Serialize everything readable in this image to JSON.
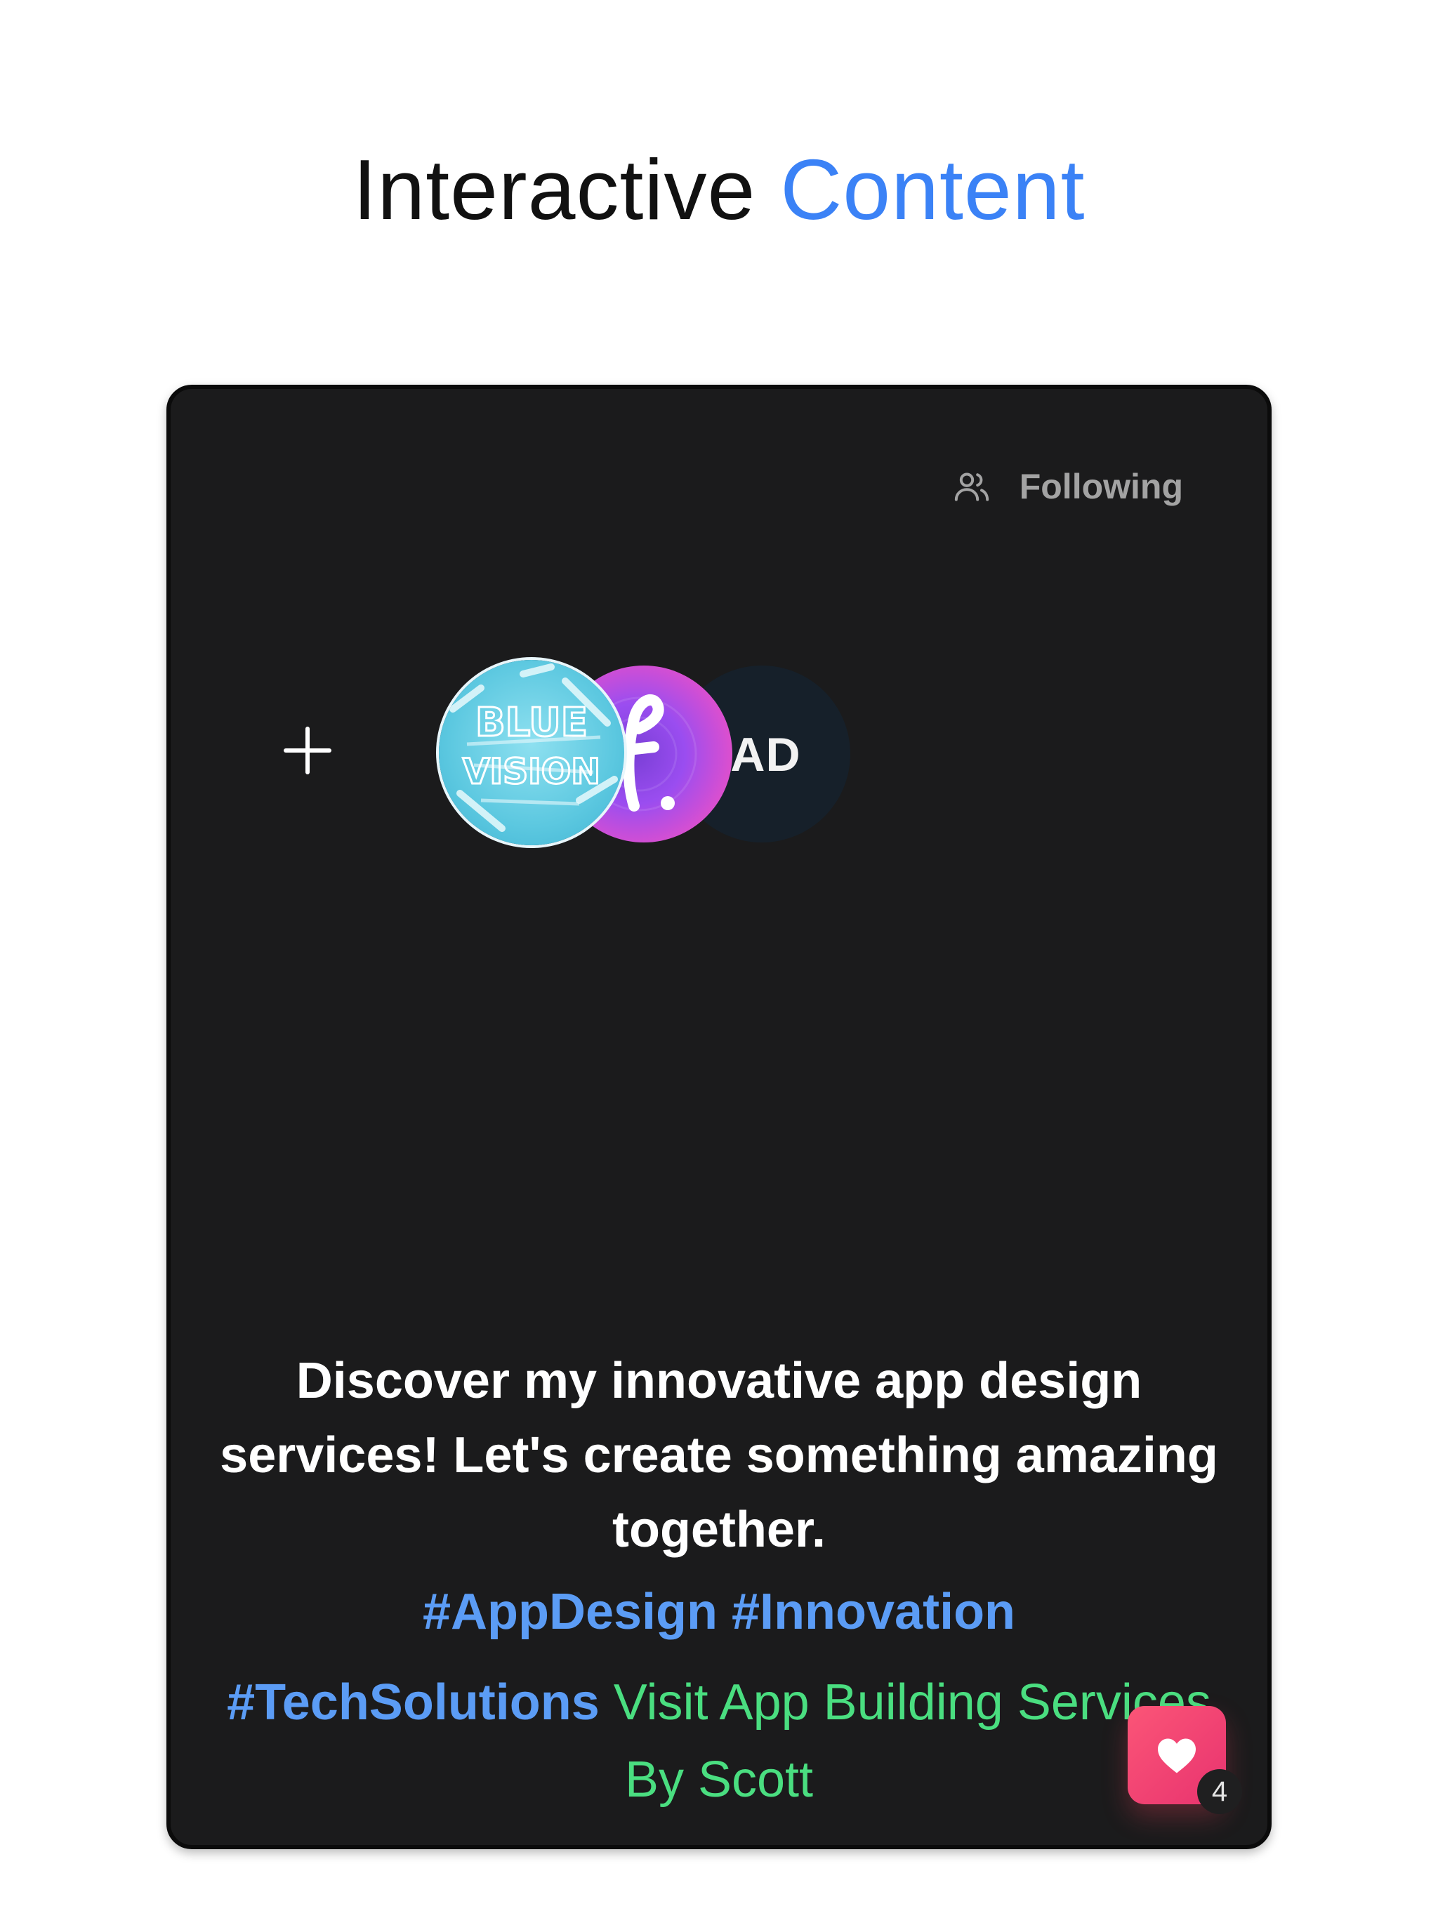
{
  "header": {
    "title_part1": "Interactive",
    "title_part2": "Content",
    "accent_color": "#3b82f6"
  },
  "card": {
    "following_label": "Following",
    "following_icon": "users-icon",
    "add_icon": "plus-icon",
    "avatars": [
      {
        "name": "blue-vision-logo",
        "text": "BLUE VISION"
      },
      {
        "name": "f-brand-logo",
        "text": "f."
      },
      {
        "name": "dark-logo",
        "text": "EAD"
      }
    ],
    "caption": "Discover my innovative app design services! Let's create something amazing together.",
    "hashtags": [
      "#AppDesign",
      "#Innovation",
      "#TechSolutions"
    ],
    "link_text": "Visit App Building Services By Scott",
    "like_icon": "heart-icon",
    "like_count": "4",
    "colors": {
      "background": "#1b1b1c",
      "hashtag": "#5b9cf5",
      "link": "#4ade80",
      "like": "#f43f5e"
    }
  }
}
